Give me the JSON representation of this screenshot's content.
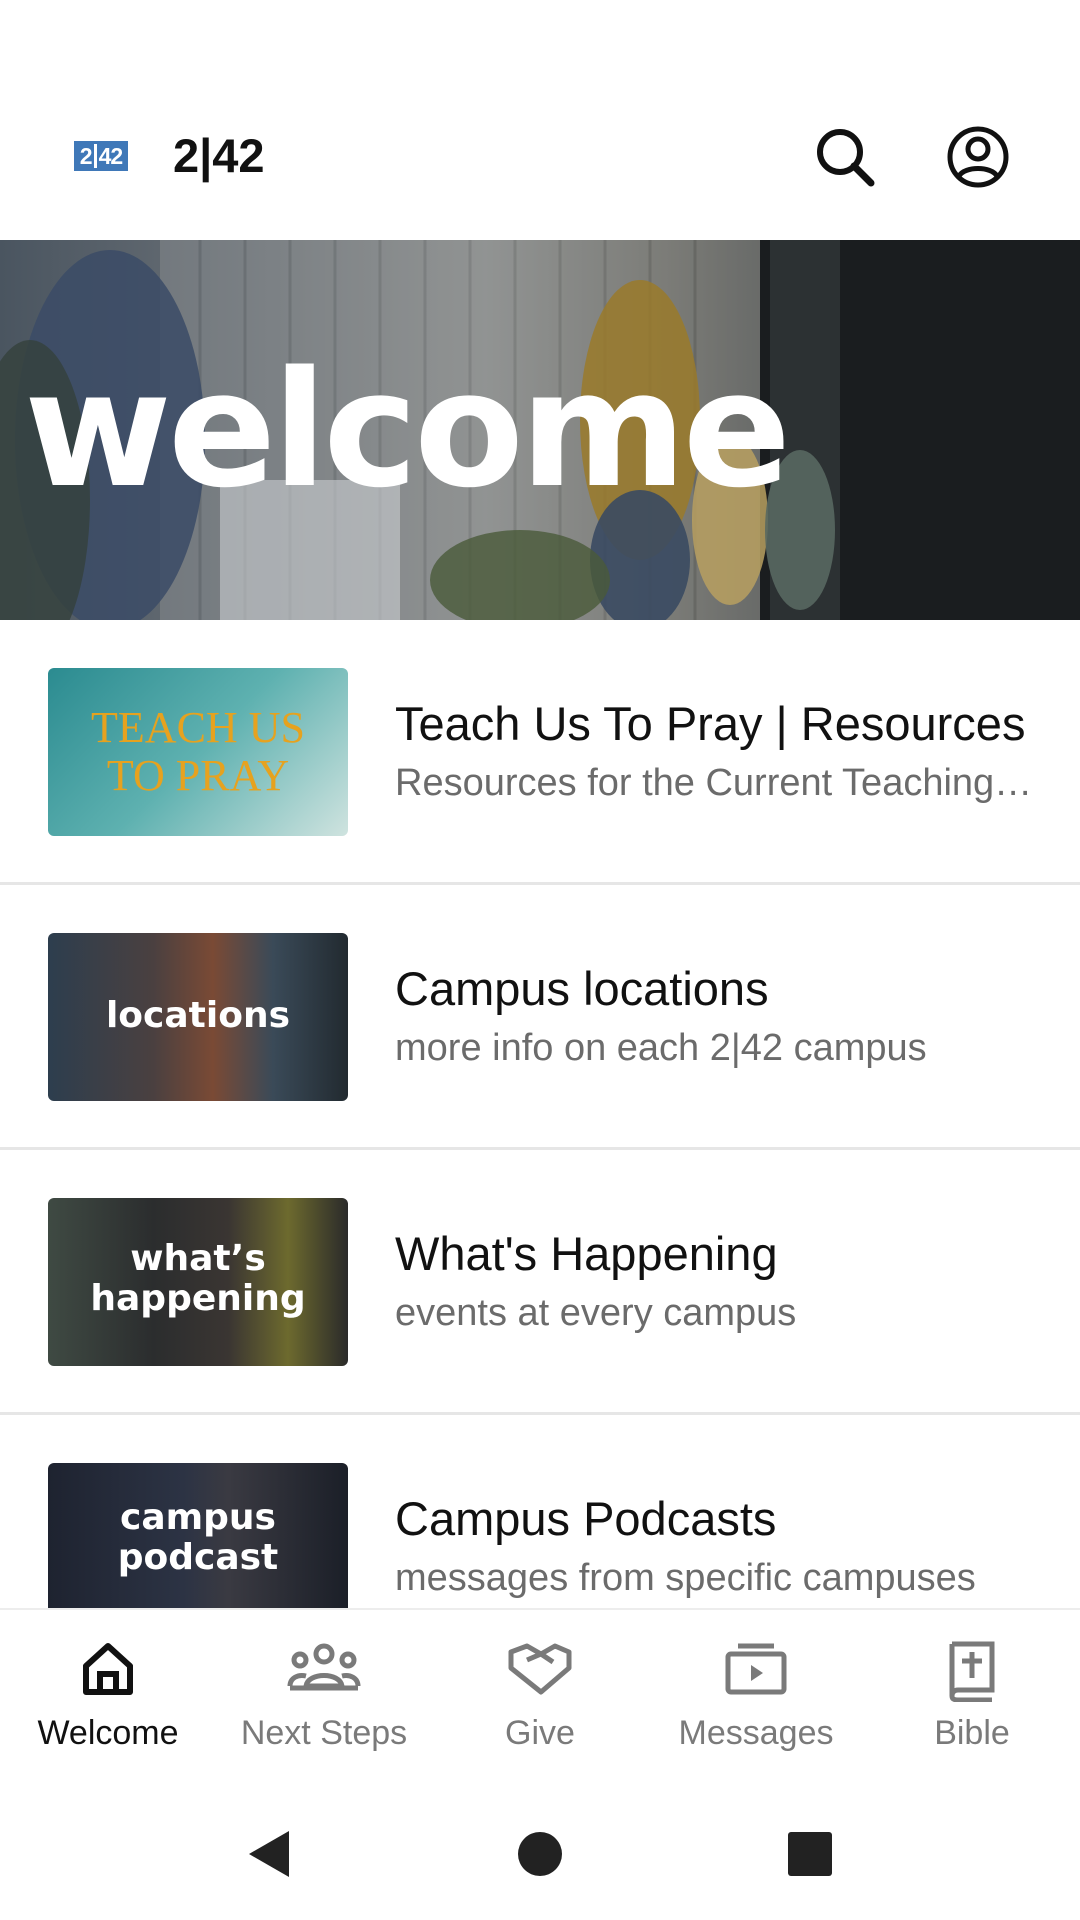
{
  "app": {
    "logo_left": "2",
    "logo_right": "42",
    "title": "2|42"
  },
  "hero": {
    "text": "welcome"
  },
  "items": [
    {
      "title": "Teach Us To Pray | Resources",
      "subtitle": "Resources for the Current Teaching Series",
      "thumb_line1": "TEACH US",
      "thumb_line2": "TO PRAY"
    },
    {
      "title": "Campus locations",
      "subtitle": "more info on each 2|42 campus",
      "thumb_line1": "locations"
    },
    {
      "title": "What's Happening",
      "subtitle": "events at every campus",
      "thumb_line1": "what’s",
      "thumb_line2": "happening"
    },
    {
      "title": "Campus Podcasts",
      "subtitle": "messages from specific campuses",
      "thumb_line1": "campus",
      "thumb_line2": "podcast"
    }
  ],
  "nav": [
    {
      "label": "Welcome",
      "icon": "home-icon",
      "active": true
    },
    {
      "label": "Next Steps",
      "icon": "group-icon",
      "active": false
    },
    {
      "label": "Give",
      "icon": "handshake-icon",
      "active": false
    },
    {
      "label": "Messages",
      "icon": "video-library-icon",
      "active": false
    },
    {
      "label": "Bible",
      "icon": "bible-icon",
      "active": false
    }
  ],
  "colors": {
    "accent": "#3f78b8",
    "text_primary": "#111111",
    "text_secondary": "#6b6b6b",
    "nav_inactive": "#7a7a7a"
  }
}
